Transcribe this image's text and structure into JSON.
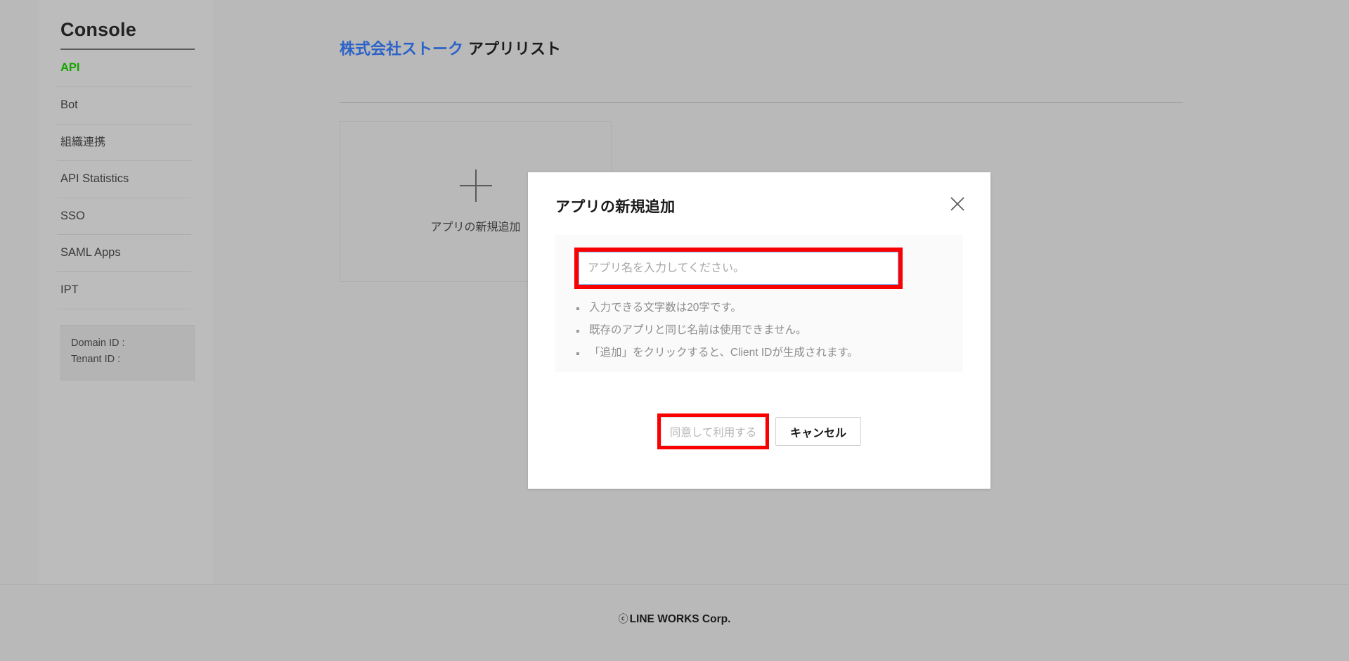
{
  "sidebar": {
    "title": "Console",
    "items": [
      {
        "label": "API",
        "active": true
      },
      {
        "label": "Bot",
        "active": false
      },
      {
        "label": "組織連携",
        "active": false
      },
      {
        "label": "API Statistics",
        "active": false
      },
      {
        "label": "SSO",
        "active": false
      },
      {
        "label": "SAML Apps",
        "active": false
      },
      {
        "label": "IPT",
        "active": false
      }
    ],
    "id_box": {
      "domain_id_label": "Domain ID :",
      "tenant_id_label": "Tenant ID :"
    }
  },
  "main": {
    "heading_brand": "株式会社ストーク",
    "heading_sub": "アプリリスト",
    "add_app_card": {
      "icon": "plus-icon",
      "label": "アプリの新規追加"
    }
  },
  "modal": {
    "title": "アプリの新規追加",
    "close_icon": "close-icon",
    "input": {
      "value": "",
      "placeholder": "アプリ名を入力してください。"
    },
    "hints": [
      "入力できる文字数は20字です。",
      "既存のアプリと同じ名前は使用できません。",
      "「追加」をクリックすると、Client IDが生成されます。"
    ],
    "buttons": {
      "agree": "同意して利用する",
      "cancel": "キャンセル"
    }
  },
  "footer": {
    "copy_mark": "ⓒ",
    "text": "LINE WORKS Corp."
  },
  "colors": {
    "page_background": "#b9b9b9",
    "sidebar_background": "#bcbcbc",
    "active_nav": "#15a500",
    "brand_blue": "#2c63c8",
    "annotation_red": "#fb0000",
    "input_focus_border": "#82b5ef",
    "modal_background": "#ffffff",
    "modal_body_background": "#fafafa"
  }
}
